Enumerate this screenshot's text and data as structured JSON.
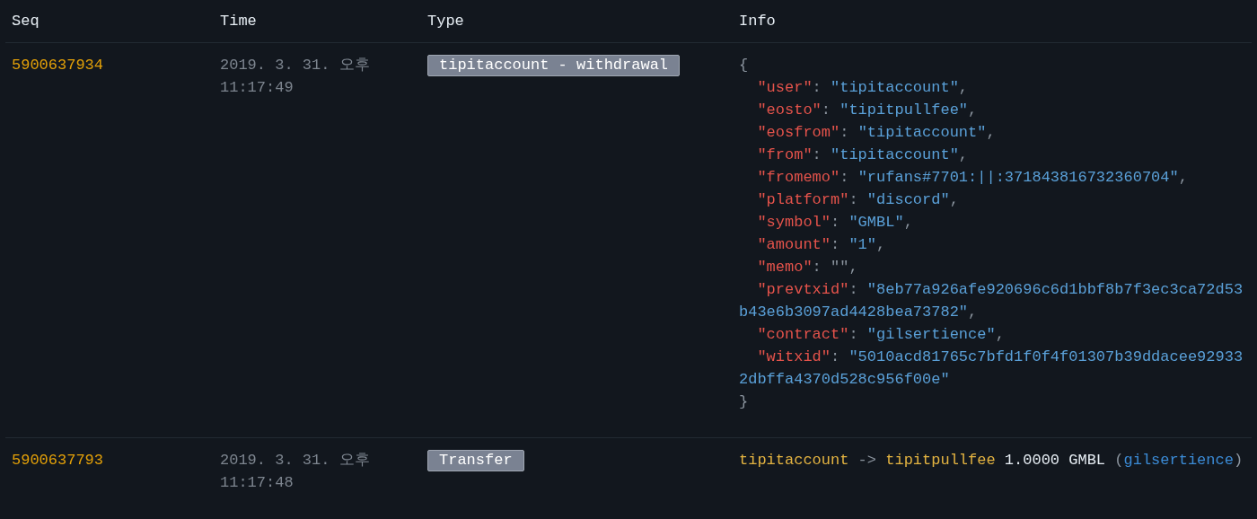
{
  "columns": [
    "Seq",
    "Time",
    "Type",
    "Info"
  ],
  "rows": [
    {
      "seq": "5900637934",
      "time": "2019. 3. 31. 오후 11:17:49",
      "type": "tipitaccount - withdrawal",
      "info": {
        "kind": "json",
        "lines": [
          {
            "indented": false,
            "parts": [
              {
                "kind": "punct",
                "text": "{"
              }
            ]
          },
          {
            "indented": true,
            "parts": [
              {
                "kind": "key",
                "text": "\"user\""
              },
              {
                "kind": "punct",
                "text": ": "
              },
              {
                "kind": "value",
                "text": "\"tipitaccount\""
              },
              {
                "kind": "punct",
                "text": ","
              }
            ]
          },
          {
            "indented": true,
            "parts": [
              {
                "kind": "key",
                "text": "\"eosto\""
              },
              {
                "kind": "punct",
                "text": ": "
              },
              {
                "kind": "value",
                "text": "\"tipitpullfee\""
              },
              {
                "kind": "punct",
                "text": ","
              }
            ]
          },
          {
            "indented": true,
            "parts": [
              {
                "kind": "key",
                "text": "\"eosfrom\""
              },
              {
                "kind": "punct",
                "text": ": "
              },
              {
                "kind": "value",
                "text": "\"tipitaccount\""
              },
              {
                "kind": "punct",
                "text": ","
              }
            ]
          },
          {
            "indented": true,
            "parts": [
              {
                "kind": "key",
                "text": "\"from\""
              },
              {
                "kind": "punct",
                "text": ": "
              },
              {
                "kind": "value",
                "text": "\"tipitaccount\""
              },
              {
                "kind": "punct",
                "text": ","
              }
            ]
          },
          {
            "indented": true,
            "parts": [
              {
                "kind": "key",
                "text": "\"fromemo\""
              },
              {
                "kind": "punct",
                "text": ": "
              },
              {
                "kind": "value",
                "text": "\"rufans#7701:||:371843816732360704\""
              },
              {
                "kind": "punct",
                "text": ","
              }
            ]
          },
          {
            "indented": true,
            "parts": [
              {
                "kind": "key",
                "text": "\"platform\""
              },
              {
                "kind": "punct",
                "text": ": "
              },
              {
                "kind": "value",
                "text": "\"discord\""
              },
              {
                "kind": "punct",
                "text": ","
              }
            ]
          },
          {
            "indented": true,
            "parts": [
              {
                "kind": "key",
                "text": "\"symbol\""
              },
              {
                "kind": "punct",
                "text": ": "
              },
              {
                "kind": "value",
                "text": "\"GMBL\""
              },
              {
                "kind": "punct",
                "text": ","
              }
            ]
          },
          {
            "indented": true,
            "parts": [
              {
                "kind": "key",
                "text": "\"amount\""
              },
              {
                "kind": "punct",
                "text": ": "
              },
              {
                "kind": "value",
                "text": "\"1\""
              },
              {
                "kind": "punct",
                "text": ","
              }
            ]
          },
          {
            "indented": true,
            "parts": [
              {
                "kind": "key",
                "text": "\"memo\""
              },
              {
                "kind": "punct",
                "text": ": \"\","
              }
            ]
          },
          {
            "indented": true,
            "parts": [
              {
                "kind": "key",
                "text": "\"prevtxid\""
              },
              {
                "kind": "punct",
                "text": ": "
              },
              {
                "kind": "value",
                "text": "\"8eb77a926afe920696c6d1bbf8b7f3ec3ca72d53b43e6b3097ad4428bea73782\""
              },
              {
                "kind": "punct",
                "text": ","
              }
            ]
          },
          {
            "indented": true,
            "parts": [
              {
                "kind": "key",
                "text": "\"contract\""
              },
              {
                "kind": "punct",
                "text": ": "
              },
              {
                "kind": "value",
                "text": "\"gilsertience\""
              },
              {
                "kind": "punct",
                "text": ","
              }
            ]
          },
          {
            "indented": true,
            "parts": [
              {
                "kind": "key",
                "text": "\"witxid\""
              },
              {
                "kind": "punct",
                "text": ": "
              },
              {
                "kind": "value",
                "text": "\"5010acd81765c7bfd1f0f4f01307b39ddacee929332dbffa4370d528c956f00e\""
              }
            ]
          },
          {
            "indented": false,
            "parts": [
              {
                "kind": "punct",
                "text": "}"
              }
            ]
          }
        ]
      }
    },
    {
      "seq": "5900637793",
      "time": "2019. 3. 31. 오후 11:17:48",
      "type": "Transfer",
      "info": {
        "kind": "transfer",
        "parts": [
          {
            "kind": "account",
            "text": "tipitaccount"
          },
          {
            "kind": "punct",
            "text": " -> "
          },
          {
            "kind": "account",
            "text": "tipitpullfee"
          },
          {
            "kind": "amount",
            "text": " 1.0000 GMBL "
          },
          {
            "kind": "punct",
            "text": "("
          },
          {
            "kind": "contract",
            "text": "gilsertience"
          },
          {
            "kind": "punct",
            "text": ")"
          }
        ]
      }
    }
  ]
}
